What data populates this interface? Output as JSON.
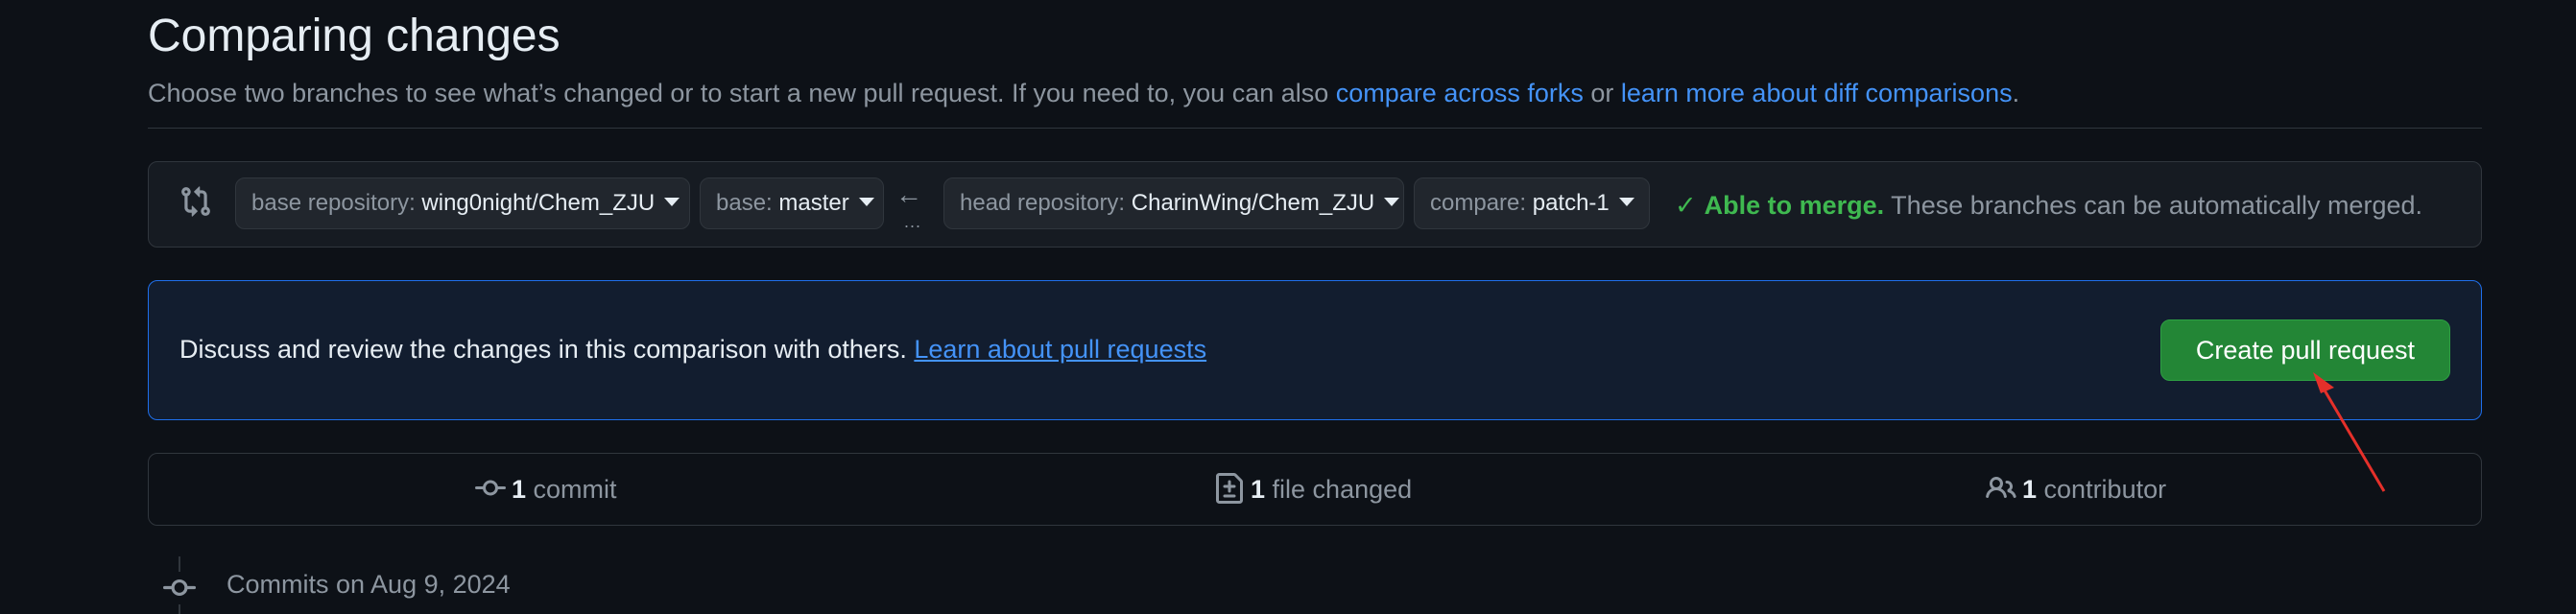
{
  "header": {
    "title": "Comparing changes",
    "subtitle_text": "Choose two branches to see what’s changed or to start a new pull request. If you need to, you can also ",
    "link_forks": "compare across forks",
    "subtitle_or": " or ",
    "link_learn_diff": "learn more about diff comparisons",
    "subtitle_end": "."
  },
  "range": {
    "base_repo_label": "base repository: ",
    "base_repo_value": "wing0night/Chem_ZJU",
    "base_label": "base: ",
    "base_value": "master",
    "arrow": "←",
    "dots": "...",
    "head_repo_label": "head repository: ",
    "head_repo_value": "CharinWing/Chem_ZJU",
    "compare_label": "compare: ",
    "compare_value": "patch-1",
    "merge_check": "✓",
    "merge_status": "Able to merge.",
    "merge_detail": " These branches can be automatically merged."
  },
  "banner": {
    "text": "Discuss and review the changes in this comparison with others. ",
    "link": "Learn about pull requests",
    "button": "Create pull request"
  },
  "stats": {
    "commits_count": "1",
    "commits_label": " commit",
    "files_count": "1",
    "files_label": " file changed",
    "contributors_count": "1",
    "contributors_label": " contributor"
  },
  "timeline": {
    "commits_on": "Commits on Aug 9, 2024"
  },
  "colors": {
    "background": "#0d1117",
    "link": "#4493f8",
    "success": "#3fb950",
    "button": "#238636",
    "annotation_arrow": "#e5302a"
  }
}
